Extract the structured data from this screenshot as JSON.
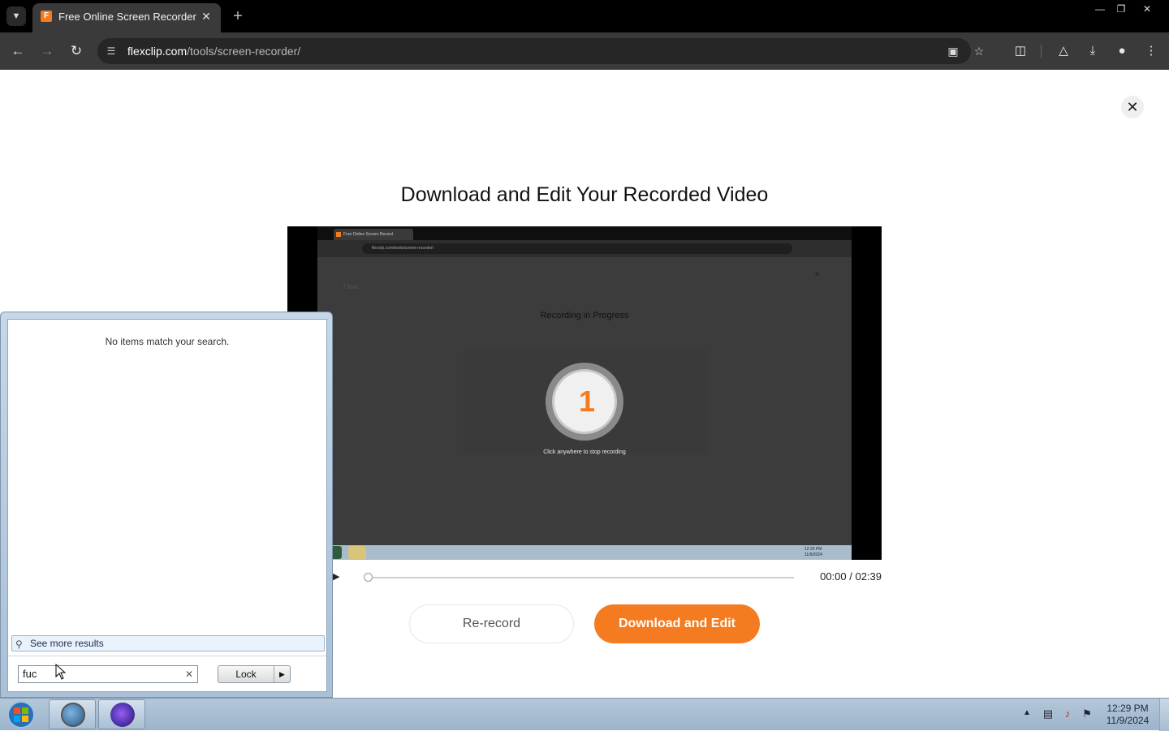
{
  "browser": {
    "tab_title": "Free Online Screen Recorder & ...",
    "url_domain": "flexclip.com",
    "url_path": "/tools/screen-recorder/"
  },
  "modal": {
    "title": "Download and Edit Your Recorded Video",
    "close_label": "✕"
  },
  "video": {
    "frame_tab_title": "Free Online Screen Record",
    "frame_url": "flexclip.com/tools/screen-recorder/",
    "frame_heading": "Recording in Progress",
    "frame_countdown": "1",
    "frame_stop_text": "Click anywhere to stop recording",
    "frame_logo": "f lexc",
    "frame_clock": "12:29 PM\n11/9/2024",
    "current_time": "00:00",
    "duration": "02:39",
    "timecode": "00:00 / 02:39",
    "progress": 0
  },
  "actions": {
    "rerecord_label": "Re-record",
    "download_label": "Download and Edit"
  },
  "start_menu": {
    "no_results_text": "No items match your search.",
    "see_more_label": "See more results",
    "search_value": "fuc",
    "lock_label": "Lock"
  },
  "taskbar": {
    "time": "12:29 PM",
    "date": "11/9/2024"
  },
  "colors": {
    "accent": "#f47b20",
    "chrome_dark": "#3a3a3a"
  }
}
